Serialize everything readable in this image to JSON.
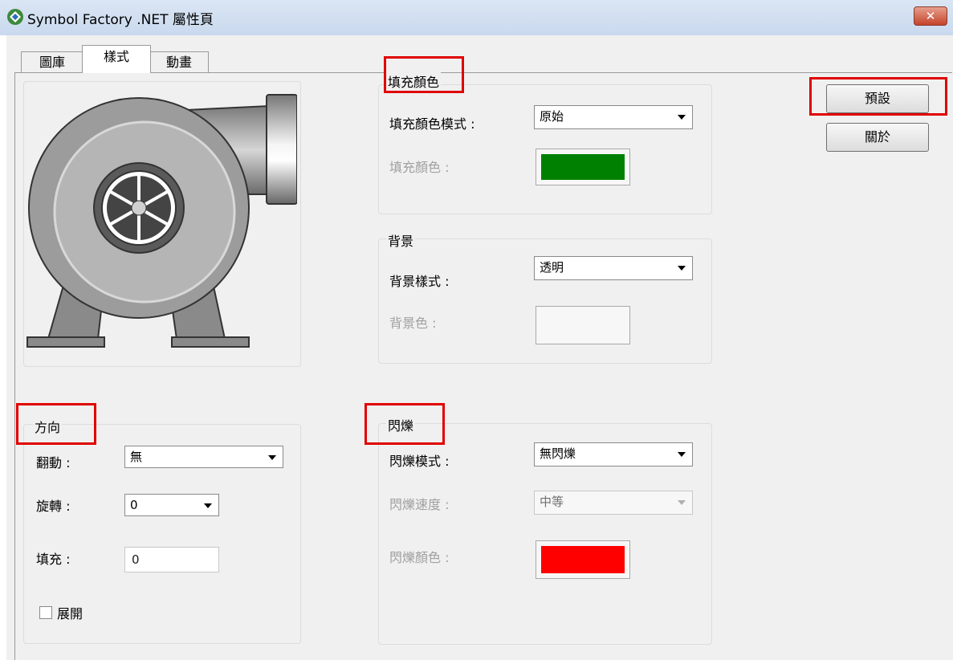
{
  "window": {
    "title": "Symbol Factory .NET 屬性頁",
    "close_label": "✕"
  },
  "tabs": [
    {
      "label": "圖庫",
      "active": false
    },
    {
      "label": "樣式",
      "active": true
    },
    {
      "label": "動畫",
      "active": false
    }
  ],
  "preview": {
    "icon": "centrifugal-blower-icon"
  },
  "fill_color_group": {
    "title": "填充顏色",
    "mode_label": "填充顏色模式 :",
    "mode_value": "原始",
    "color_label": "填充顏色 :",
    "color": "#008000"
  },
  "background_group": {
    "title": "背景",
    "style_label": "背景樣式 :",
    "style_value": "透明",
    "color_label": "背景色 :"
  },
  "direction_group": {
    "title": "方向",
    "flip_label": "翻動 :",
    "flip_value": "無",
    "rotate_label": "旋轉 :",
    "rotate_value": "0",
    "fill_label": "填充 :",
    "fill_value": "0",
    "expand_label": "展開",
    "expand_checked": false
  },
  "blink_group": {
    "title": "閃爍",
    "mode_label": "閃爍模式 :",
    "mode_value": "無閃爍",
    "speed_label": "閃爍速度 :",
    "speed_value": "中等",
    "color_label": "閃爍顏色 :",
    "color": "#ff0000"
  },
  "buttons": {
    "default_label": "預設",
    "about_label": "關於"
  },
  "highlight_color": "#e00000"
}
